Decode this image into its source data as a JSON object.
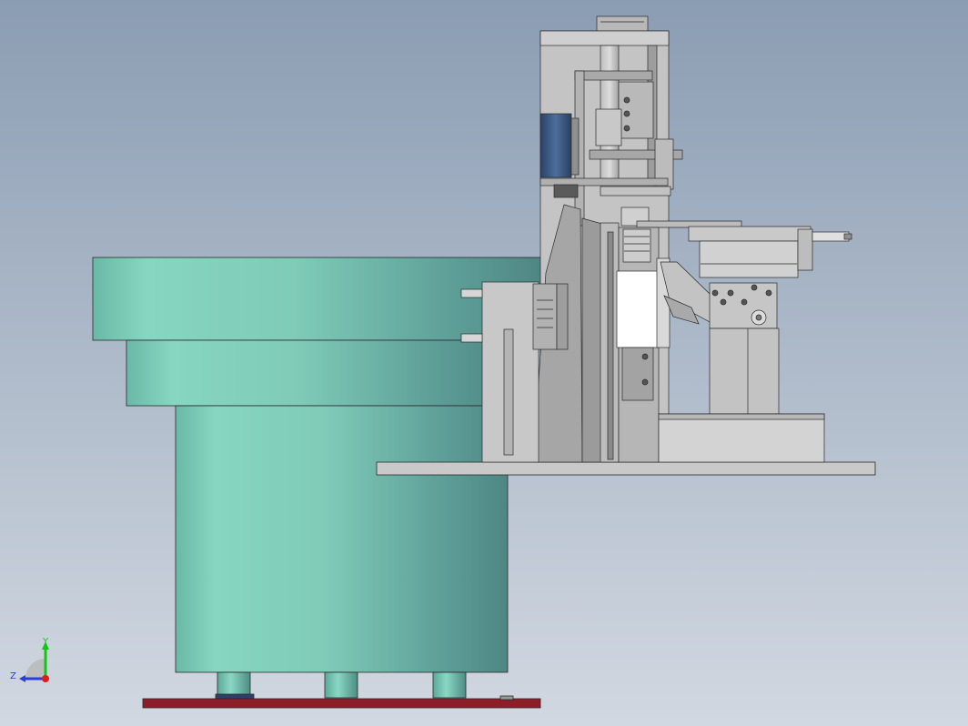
{
  "viewport": {
    "background_top": "#8b9db3",
    "background_bottom": "#d2d8e1"
  },
  "colors": {
    "bowl_light": "#86d6c1",
    "bowl_dark": "#4f8684",
    "metal_light": "#d4d4d4",
    "metal_mid": "#a9a9a9",
    "metal_dark": "#6d6d6d",
    "motor_blue": "#3c5a86",
    "base_plate_red": "#8e1d2a",
    "outline": "#2a2a2a"
  },
  "triad": {
    "x_axis_color": "#e01b1b",
    "y_axis_color": "#14c414",
    "z_axis_color": "#2b3ed8",
    "x_label": "",
    "y_label": "Y",
    "z_label": "Z"
  }
}
